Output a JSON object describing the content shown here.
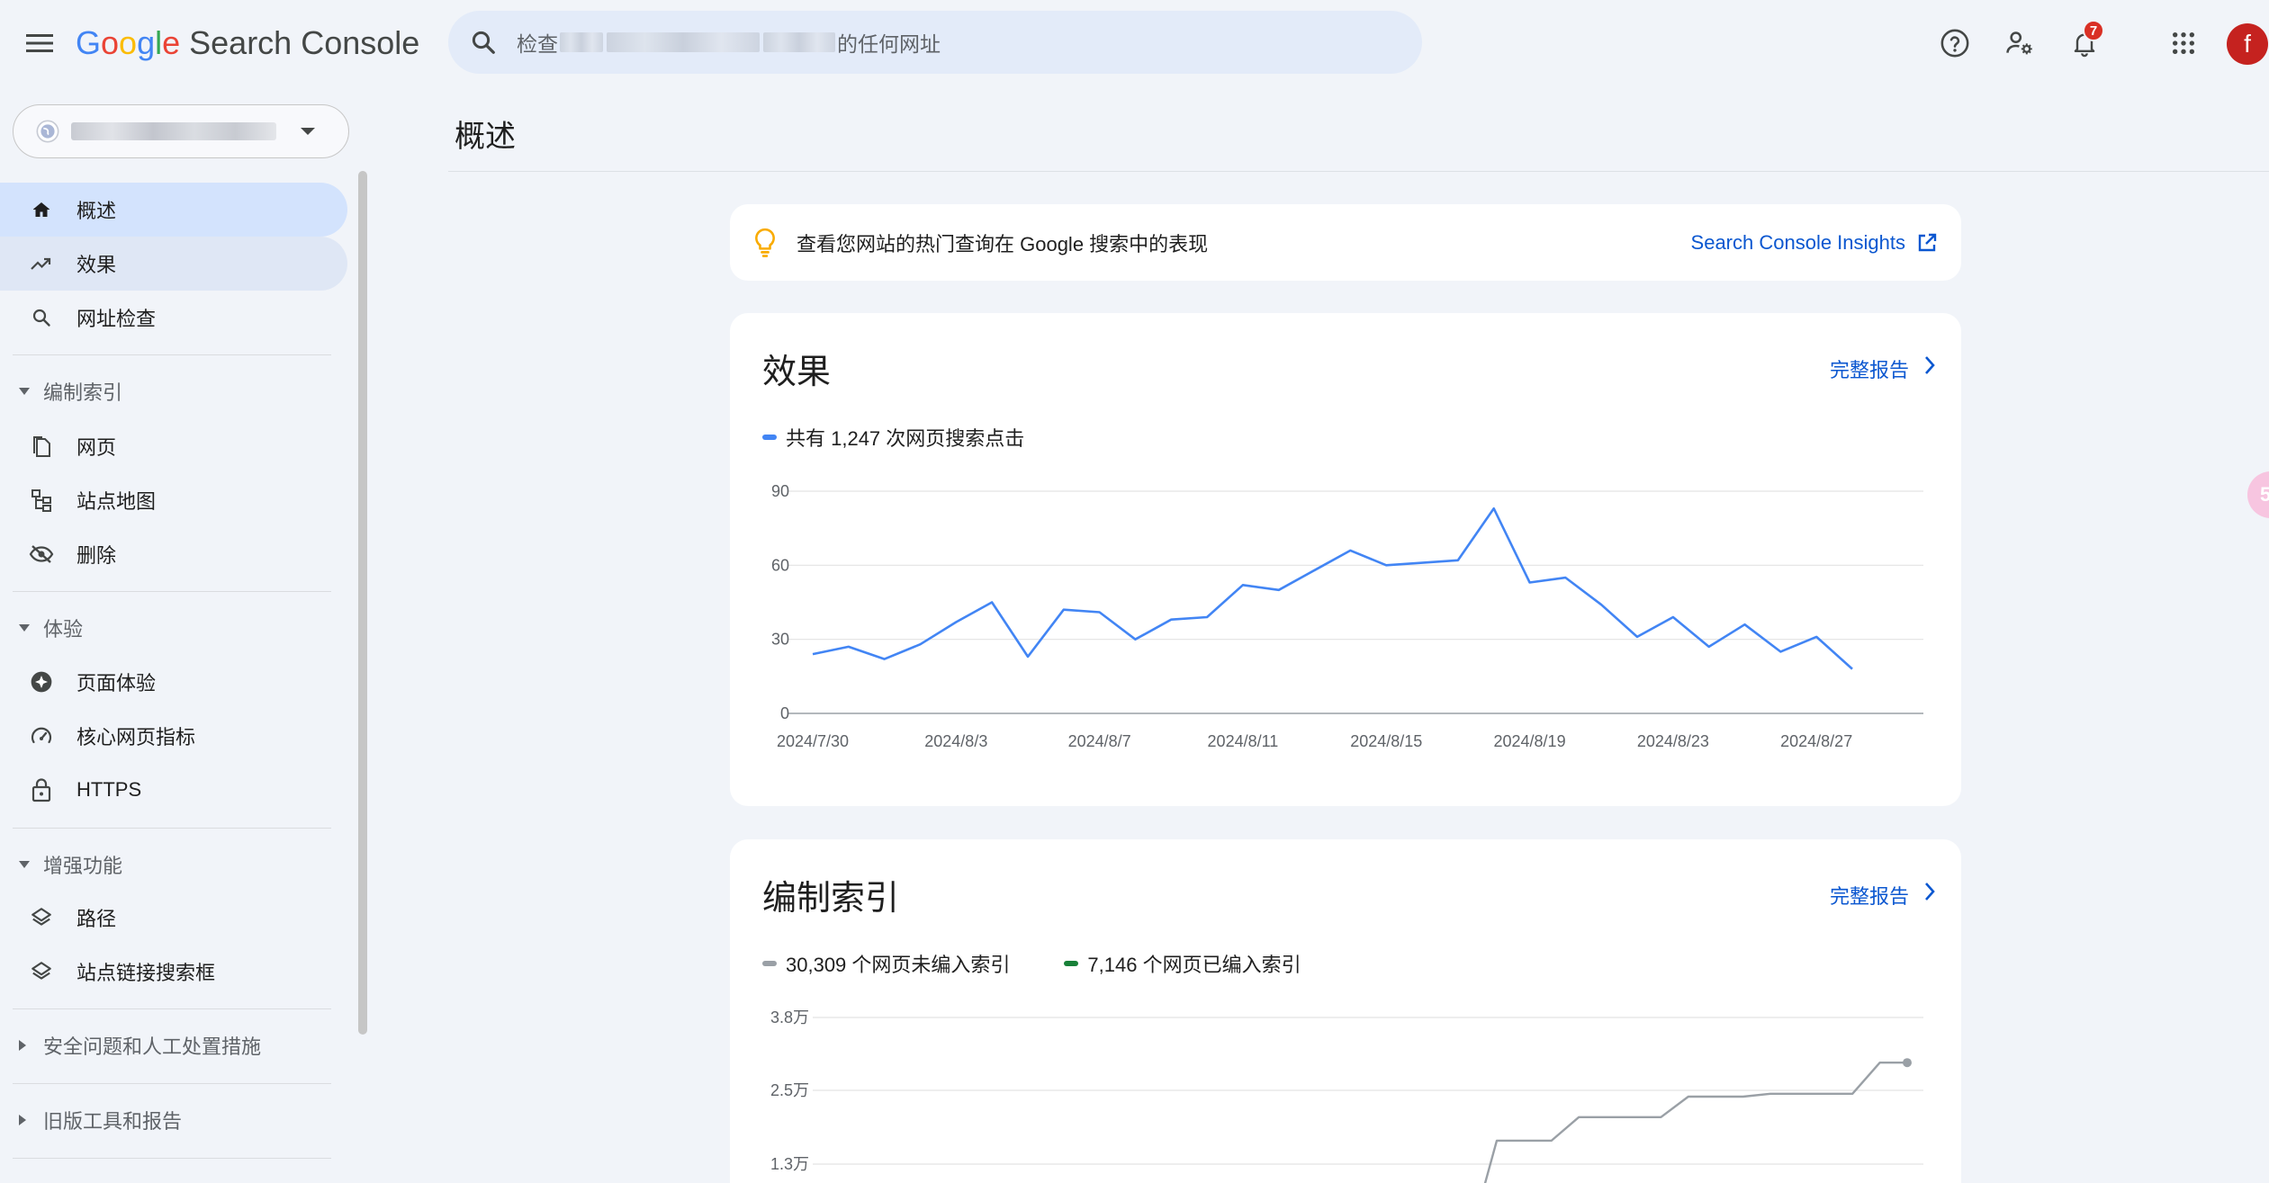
{
  "header": {
    "logo_letters": [
      "G",
      "o",
      "o",
      "g",
      "l",
      "e"
    ],
    "product_name": "Search Console",
    "search_prefix": "检查",
    "search_suffix": "的任何网址",
    "notification_count": "7",
    "avatar_letter": "f"
  },
  "sidebar": {
    "items_top": [
      {
        "label": "概述",
        "icon": "home-icon"
      },
      {
        "label": "效果",
        "icon": "trending-up-icon"
      },
      {
        "label": "网址检查",
        "icon": "search-icon"
      }
    ],
    "sections": [
      {
        "label": "编制索引",
        "items": [
          {
            "label": "网页",
            "icon": "pages-icon"
          },
          {
            "label": "站点地图",
            "icon": "sitemap-icon"
          },
          {
            "label": "删除",
            "icon": "visibility-off-icon"
          }
        ]
      },
      {
        "label": "体验",
        "items": [
          {
            "label": "页面体验",
            "icon": "page-experience-icon"
          },
          {
            "label": "核心网页指标",
            "icon": "speed-gauge-icon"
          },
          {
            "label": "HTTPS",
            "icon": "lock-icon"
          }
        ]
      },
      {
        "label": "增强功能",
        "items": [
          {
            "label": "路径",
            "icon": "layers-icon"
          },
          {
            "label": "站点链接搜索框",
            "icon": "layers-icon"
          }
        ]
      }
    ],
    "collapsed_sections": [
      {
        "label": "安全问题和人工处置措施"
      },
      {
        "label": "旧版工具和报告"
      }
    ]
  },
  "main": {
    "page_title": "概述",
    "insights": {
      "text": "查看您网站的热门查询在 Google 搜索中的表现",
      "link": "Search Console Insights"
    },
    "performance": {
      "title": "效果",
      "report_link": "完整报告",
      "legend": "共有 1,247 次网页搜索点击"
    },
    "indexing": {
      "title": "编制索引",
      "report_link": "完整报告",
      "legend_not_indexed": "30,309 个网页未编入索引",
      "legend_indexed": "7,146 个网页已编入索引"
    }
  },
  "colors": {
    "accent_blue": "#0b57d0",
    "series_blue": "#4285f4",
    "series_grey": "#9aa0a6",
    "series_green": "#188038",
    "selected_nav": "#d3e3fd"
  },
  "chart_data": [
    {
      "type": "line",
      "series": [
        {
          "name": "共有 1,247 次网页搜索点击",
          "values": [
            24,
            27,
            22,
            28,
            37,
            45,
            23,
            42,
            41,
            30,
            38,
            39,
            52,
            50,
            58,
            66,
            60,
            61,
            62,
            83,
            53,
            55,
            44,
            31,
            39,
            27,
            36,
            25,
            31,
            18
          ]
        }
      ],
      "x": [
        "2024/7/30",
        "2024/7/31",
        "2024/8/1",
        "2024/8/2",
        "2024/8/3",
        "2024/8/4",
        "2024/8/5",
        "2024/8/6",
        "2024/8/7",
        "2024/8/8",
        "2024/8/9",
        "2024/8/10",
        "2024/8/11",
        "2024/8/12",
        "2024/8/13",
        "2024/8/14",
        "2024/8/15",
        "2024/8/16",
        "2024/8/17",
        "2024/8/18",
        "2024/8/19",
        "2024/8/20",
        "2024/8/21",
        "2024/8/22",
        "2024/8/23",
        "2024/8/24",
        "2024/8/25",
        "2024/8/26",
        "2024/8/27",
        "2024/8/28"
      ],
      "x_tick_labels": [
        "2024/7/30",
        "2024/8/3",
        "2024/8/7",
        "2024/8/11",
        "2024/8/15",
        "2024/8/19",
        "2024/8/23",
        "2024/8/27"
      ],
      "y_tick_labels": [
        "0",
        "30",
        "60",
        "90"
      ],
      "ylim": [
        0,
        90
      ],
      "grid": true
    },
    {
      "type": "line",
      "series": [
        {
          "name": "30,309 个网页未编入索引",
          "values": [
            0,
            0,
            0,
            0,
            0,
            0,
            0,
            0,
            0,
            0,
            0,
            0,
            0,
            0,
            0,
            0,
            0,
            0,
            0,
            0,
            0,
            0,
            0,
            0,
            0,
            17000,
            17000,
            17000,
            21000,
            21000,
            21000,
            21000,
            24500,
            24500,
            24500,
            25000,
            25000,
            25000,
            25000,
            30300,
            30300
          ]
        }
      ],
      "y_tick_labels": [
        "1.3万",
        "2.5万",
        "3.8万"
      ],
      "ylim": [
        0,
        38000
      ],
      "grid": true
    }
  ]
}
